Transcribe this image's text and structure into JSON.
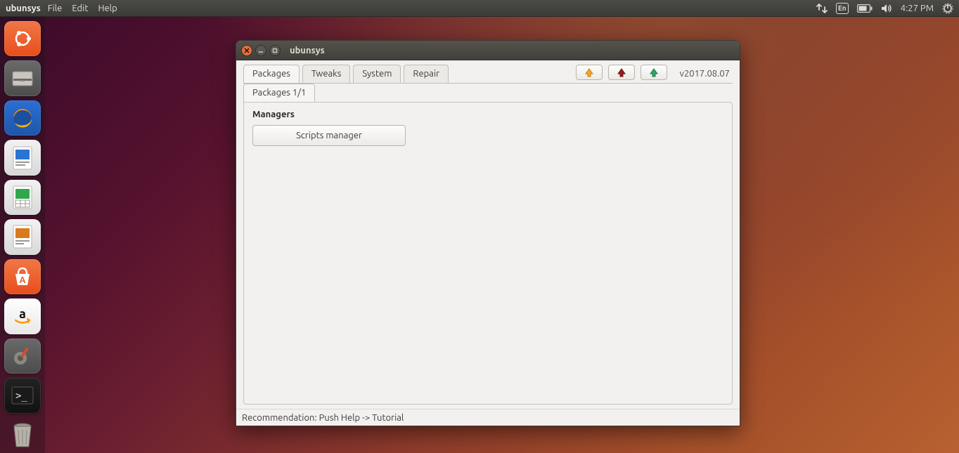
{
  "menubar": {
    "app_name": "ubunsys",
    "items": [
      "File",
      "Edit",
      "Help"
    ],
    "indicators": {
      "keyboard": "En",
      "time": "4:27 PM"
    }
  },
  "launcher": {
    "items": [
      {
        "name": "dash-icon"
      },
      {
        "name": "files-icon"
      },
      {
        "name": "firefox-icon"
      },
      {
        "name": "writer-icon"
      },
      {
        "name": "calc-icon"
      },
      {
        "name": "impress-icon"
      },
      {
        "name": "software-center-icon"
      },
      {
        "name": "amazon-icon"
      },
      {
        "name": "settings-icon"
      },
      {
        "name": "terminal-icon"
      },
      {
        "name": "trash-icon"
      }
    ]
  },
  "window": {
    "title": "ubunsys",
    "version": "v2017.08.07",
    "tabs": [
      "Packages",
      "Tweaks",
      "System",
      "Repair"
    ],
    "active_tab": 0,
    "subtabs": [
      "Packages 1/1"
    ],
    "content": {
      "section_title": "Managers",
      "scripts_button": "Scripts manager"
    },
    "statusbar": "Recommendation: Push Help -> Tutorial"
  }
}
